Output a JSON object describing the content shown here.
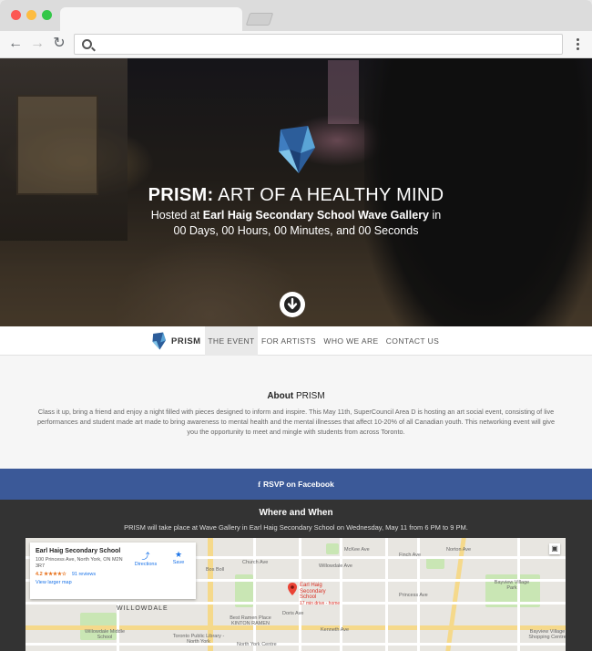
{
  "browser": {
    "url": ""
  },
  "hero": {
    "title_strong": "PRISM:",
    "title_rest": " ART OF A HEALTHY MIND",
    "line1_prefix": "Hosted at ",
    "line1_venue": "Earl Haig Secondary School Wave Gallery",
    "line1_suffix": " in",
    "countdown": "00 Days, 00 Hours, 00 Minutes, and 00 Seconds"
  },
  "nav": {
    "brand": "PRISM",
    "items": [
      {
        "label": "THE EVENT",
        "active": true
      },
      {
        "label": "FOR ARTISTS",
        "active": false
      },
      {
        "label": "WHO WE ARE",
        "active": false
      },
      {
        "label": "CONTACT US",
        "active": false
      }
    ]
  },
  "about": {
    "heading_strong": "About",
    "heading_rest": " PRISM",
    "body": "Class it up, bring a friend and enjoy a night filled with pieces designed to inform and inspire. This May 11th, SuperCouncil Area D is hosting an art social event, consisting of live performances and student made art made to bring awareness to mental health and the mental illnesses that affect 10-20% of all Canadian youth. This networking event will give you the opportunity to meet and mingle with students from across Toronto."
  },
  "rsvp": {
    "label": "RSVP on Facebook"
  },
  "where": {
    "heading": "Where and When",
    "details": "PRISM will take place at Wave Gallery in Earl Haig Secondary School on Wednesday, May 11 from 6 PM to 9 PM."
  },
  "map": {
    "card": {
      "title": "Earl Haig Secondary School",
      "address": "100 Princess Ave, North York, ON M2N 3R7",
      "rating": "4.2 ★★★★☆",
      "reviews": "91 reviews",
      "larger": "View larger map",
      "directions": "Directions",
      "save": "Save"
    },
    "pin_title": "Earl Haig Secondary School",
    "pin_sub": "17 min drive - home",
    "labels": {
      "willowdale": "WILLOWDALE",
      "willowdale_middle": "Willowdale Middle School",
      "best_ramen": "Best Ramen Place KINTON RAMEN",
      "bayview_village": "Bayview Village Park",
      "bayview_centre": "Bayview Village Shopping Centre",
      "toronto_library": "Toronto Public Library - North York",
      "north_york_centre": "North York Centre",
      "bosboll": "Bos Boll",
      "mckee": "McKee Ave",
      "church": "Church Ave",
      "doris": "Doris Ave",
      "kenneth": "Kenneth Ave",
      "willowdale_ave": "Willowdale Ave",
      "princess": "Princess Ave",
      "finch": "Finch Ave",
      "norton": "Norton Ave"
    }
  }
}
